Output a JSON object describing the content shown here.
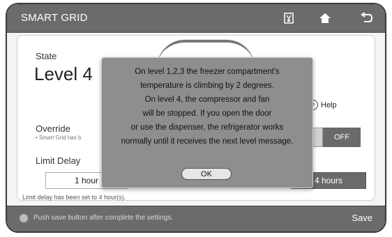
{
  "app": {
    "title": "SMART GRID"
  },
  "topbar": {
    "icons": [
      "dispenser-icon",
      "home-icon",
      "back-icon"
    ]
  },
  "state": {
    "label": "State",
    "value": "Level 4"
  },
  "help": {
    "label": "Help",
    "glyph": "?"
  },
  "override": {
    "label": "Override",
    "note": "• Smart Grid has b",
    "off_label": "OFF"
  },
  "limit_delay": {
    "label": "Limit Delay",
    "option_1": "1 hour",
    "option_selected": "4 hours",
    "status": "Limit delay has been set to 4 hour(s)."
  },
  "bottom": {
    "hint": "Push save button after complete the settings.",
    "save_label": "Save"
  },
  "dialog": {
    "lines": [
      "On level 1,2,3 the freezer compartment's",
      "temperature is climbing by 2 degrees.",
      "On level 4, the compressor and fan",
      "will be stopped. If you open the door",
      "or use the dispenser, the refrigerator works",
      "normally until it receives the next level message."
    ],
    "ok_label": "OK"
  },
  "colors": {
    "bar": "#6b6b6b",
    "dialog": "#8e8e8e",
    "selected": "#6a6a6a"
  }
}
